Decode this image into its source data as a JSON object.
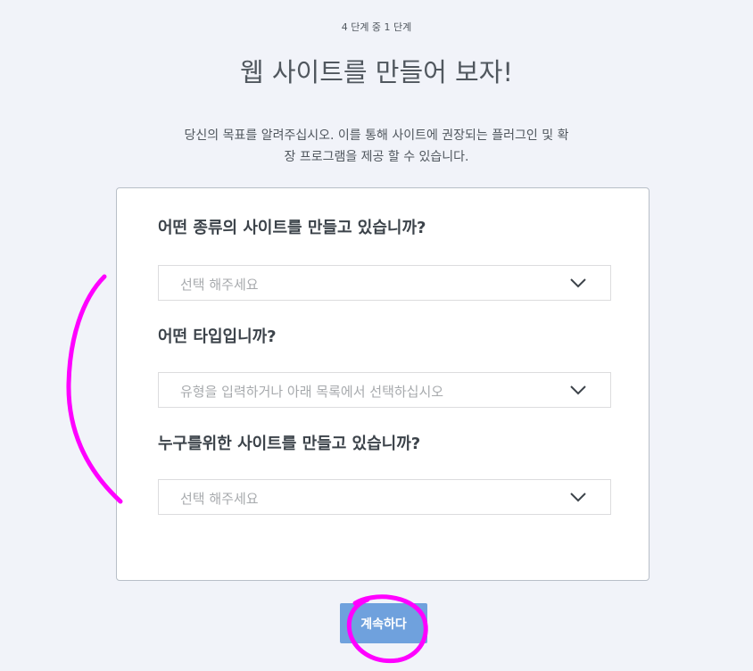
{
  "header": {
    "step": "4 단계 중 1 단계",
    "title": "웹 사이트를 만들어 보자!",
    "description_line1": "당신의 목표를 알려주십시오. 이를 통해 사이트에 권장되는 플러그인 및 확",
    "description_line2": "장 프로그램을 제공 할 수 있습니다."
  },
  "form": {
    "questions": [
      {
        "label": "어떤 종류의 사이트를 만들고 있습니까?",
        "placeholder": "선택 해주세요"
      },
      {
        "label": "어떤 타입입니까?",
        "placeholder": "유형을 입력하거나 아래 목록에서 선택하십시오"
      },
      {
        "label": "누구를위한 사이트를 만들고 있습니까?",
        "placeholder": "선택 해주세요"
      }
    ]
  },
  "actions": {
    "continue_label": "계속하다"
  },
  "colors": {
    "background": "#f1f3f9",
    "button": "#6fa1dd",
    "annotation": "#ff00ff"
  },
  "icons": {
    "dropdown": "chevron-down-icon"
  }
}
